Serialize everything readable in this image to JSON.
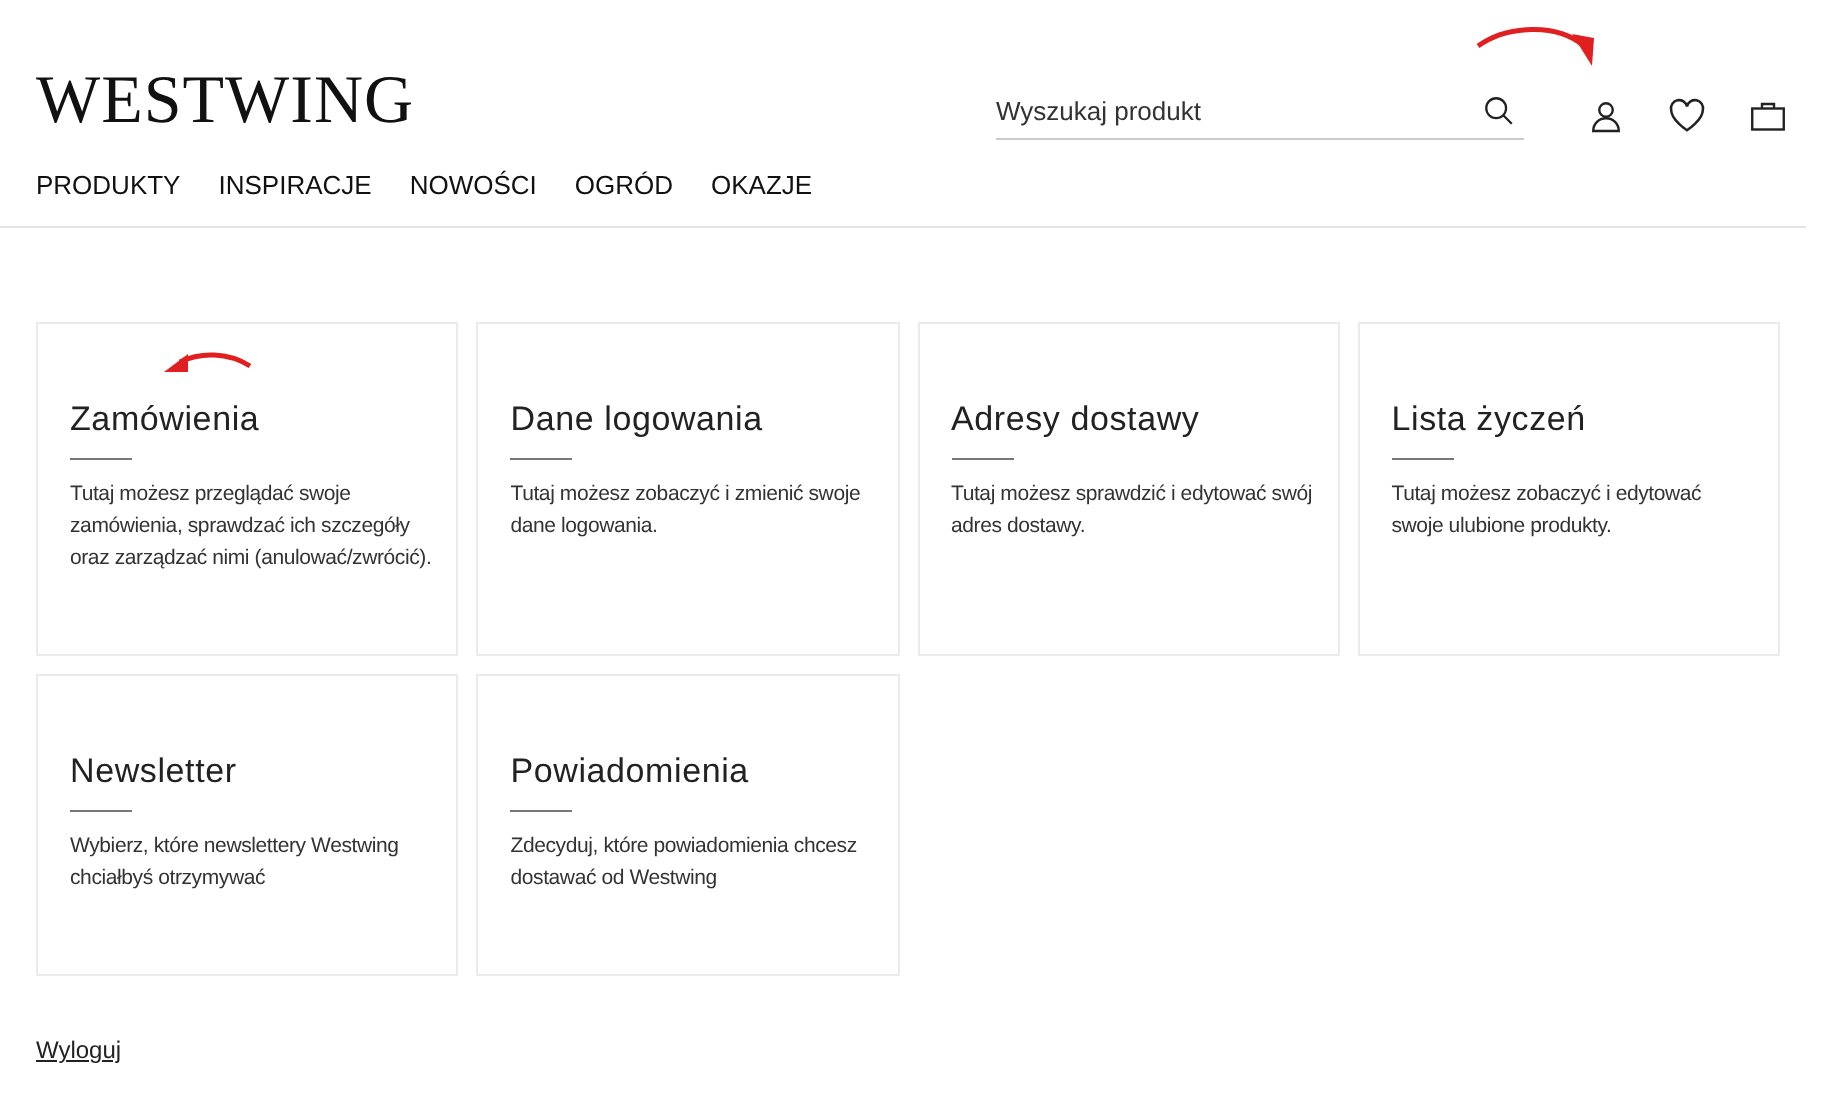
{
  "header": {
    "logo": "WESTWING",
    "search": {
      "placeholder": "Wyszukaj produkt"
    }
  },
  "nav": [
    "PRODUKTY",
    "INSPIRACJE",
    "NOWOŚCI",
    "OGRÓD",
    "OKAZJE"
  ],
  "cards": [
    {
      "title": "Zamówienia",
      "description": "Tutaj możesz przeglądać swoje zamówienia, sprawdzać ich szczegóły oraz zarządzać nimi (anulować/zwrócić)."
    },
    {
      "title": "Dane logowania",
      "description": "Tutaj możesz zobaczyć i zmienić swoje dane logowania."
    },
    {
      "title": "Adresy dostawy",
      "description": "Tutaj możesz sprawdzić i edytować swój adres dostawy."
    },
    {
      "title": "Lista życzeń",
      "description": "Tutaj możesz zobaczyć i edytować swoje ulubione produkty."
    },
    {
      "title": "Newsletter",
      "description": "Wybierz, które newslettery Westwing chciałbyś otrzymywać"
    },
    {
      "title": "Powiadomienia",
      "description": "Zdecyduj, które powiadomienia chcesz dostawać od Westwing"
    }
  ],
  "logout": "Wyloguj"
}
